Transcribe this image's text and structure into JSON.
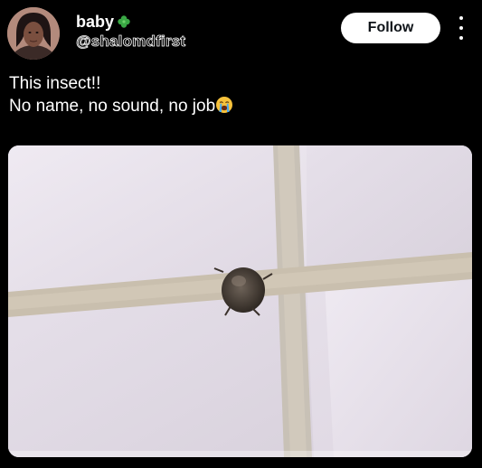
{
  "author": {
    "display_name": "baby",
    "name_emoji": "four-leaf-clover-icon",
    "handle": "@shalomdfirst",
    "avatar": "avatar-photo"
  },
  "actions": {
    "follow_label": "Follow",
    "more_icon": "more-options-icon"
  },
  "post": {
    "text_line_1": "This insect!!",
    "text_line_2": "No name, no sound, no job",
    "text_emoji": "loudly-crying-face-icon"
  },
  "media": {
    "description_icon": "photo-insect-on-tile-wall"
  },
  "colors": {
    "background": "#000000",
    "text": "#ffffff",
    "follow_bg": "#ffffff",
    "follow_text": "#0f1419"
  }
}
